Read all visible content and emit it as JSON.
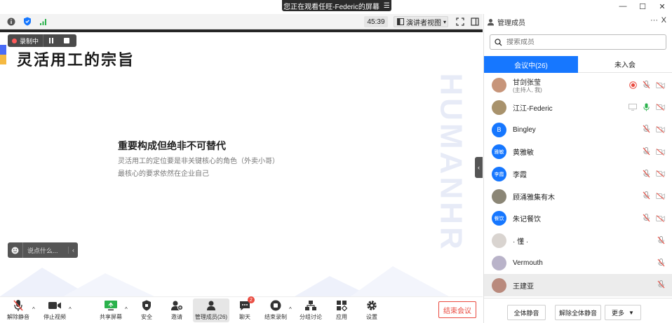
{
  "window": {
    "share_banner": "您正在观看任旺-Federic的屏幕",
    "banner_menu_icon": "hamburger-icon",
    "controls": [
      "—",
      "☐",
      "✕"
    ]
  },
  "toolbar": {
    "meeting_time": "45:39",
    "view_mode": "演讲者视图",
    "icons": [
      "info-icon",
      "shield-icon",
      "signal-icon",
      "fullscreen-icon",
      "sidebar-toggle-icon"
    ]
  },
  "recording": {
    "label": "录制中"
  },
  "slide": {
    "title": "灵活用工的宗旨",
    "watermark": "HUMANHR",
    "heading": "重要构成但绝非不可替代",
    "line1": "灵活用工的定位要是非关键核心的角色（外卖小哥）",
    "line2": "最核心的要求依然在企业自己",
    "accent_colors": [
      "#4a6cf7",
      "#f5b942"
    ]
  },
  "chat_input": {
    "placeholder": "说点什么..."
  },
  "bottombar": {
    "buttons": [
      {
        "label": "解除静音",
        "icon": "mic-off-icon"
      },
      {
        "label": "停止视频",
        "icon": "video-camera-icon"
      },
      {
        "label": "共享屏幕",
        "icon": "share-screen-icon"
      },
      {
        "label": "安全",
        "icon": "shield-icon"
      },
      {
        "label": "邀请",
        "icon": "add-user-icon"
      },
      {
        "label": "管理成员(26)",
        "icon": "members-icon"
      },
      {
        "label": "聊天",
        "icon": "chat-icon",
        "badge": "2"
      },
      {
        "label": "结束录制",
        "icon": "stop-record-icon"
      },
      {
        "label": "分组讨论",
        "icon": "breakout-icon"
      },
      {
        "label": "应用",
        "icon": "apps-icon"
      },
      {
        "label": "设置",
        "icon": "gear-icon"
      }
    ],
    "end_meeting": "结束会议"
  },
  "panel": {
    "title": "管理成员",
    "more": "···",
    "close": "X",
    "search_placeholder": "搜索成员",
    "tab_in_meeting": "会议中(26)",
    "tab_not_joined": "未入会",
    "members": [
      {
        "name": "甘剑张莹",
        "sub": "(主持人, 我)",
        "avatar_type": "photo",
        "avatar_color": "#c7957a",
        "icons": [
          "recording-icon",
          "mic-off-icon",
          "camera-off-icon"
        ]
      },
      {
        "name": "江江-Federic",
        "sub": "",
        "avatar_type": "photo",
        "avatar_color": "#a8926c",
        "icons": [
          "screen-share-icon",
          "mic-on-icon",
          "camera-off-icon"
        ]
      },
      {
        "name": "Bingley",
        "sub": "",
        "avatar_type": "letter",
        "avatar_text": "B",
        "avatar_color": "#1677ff",
        "icons": [
          "mic-off-icon",
          "camera-off-icon"
        ]
      },
      {
        "name": "黄雅敏",
        "sub": "",
        "avatar_type": "letter",
        "avatar_text": "雅敏",
        "avatar_color": "#1677ff",
        "icons": [
          "mic-off-icon",
          "camera-off-icon"
        ]
      },
      {
        "name": "李霞",
        "sub": "",
        "avatar_type": "letter",
        "avatar_text": "李霞",
        "avatar_color": "#1677ff",
        "icons": [
          "mic-off-icon",
          "camera-off-icon"
        ]
      },
      {
        "name": "顾涌雅集有木",
        "sub": "",
        "avatar_type": "photo",
        "avatar_color": "#8b8676",
        "icons": [
          "mic-off-icon",
          "camera-off-icon"
        ]
      },
      {
        "name": "朱记餐饮",
        "sub": "",
        "avatar_type": "letter",
        "avatar_text": "餐饮",
        "avatar_color": "#1677ff",
        "icons": [
          "mic-off-icon",
          "camera-off-icon"
        ]
      },
      {
        "name": "· 懂 ·",
        "sub": "",
        "avatar_type": "photo",
        "avatar_color": "#d9d4d0",
        "icons": [
          "mic-off-icon"
        ]
      },
      {
        "name": "Vermouth",
        "sub": "",
        "avatar_type": "photo",
        "avatar_color": "#b9b3c9",
        "icons": [
          "mic-off-icon"
        ]
      },
      {
        "name": "王建亚",
        "sub": "",
        "avatar_type": "photo",
        "avatar_color": "#b98a7d",
        "icons": [
          "mic-off-icon"
        ]
      }
    ],
    "mute_all": "全体静音",
    "unmute_all": "解除全体静音",
    "more_btn": "更多"
  }
}
